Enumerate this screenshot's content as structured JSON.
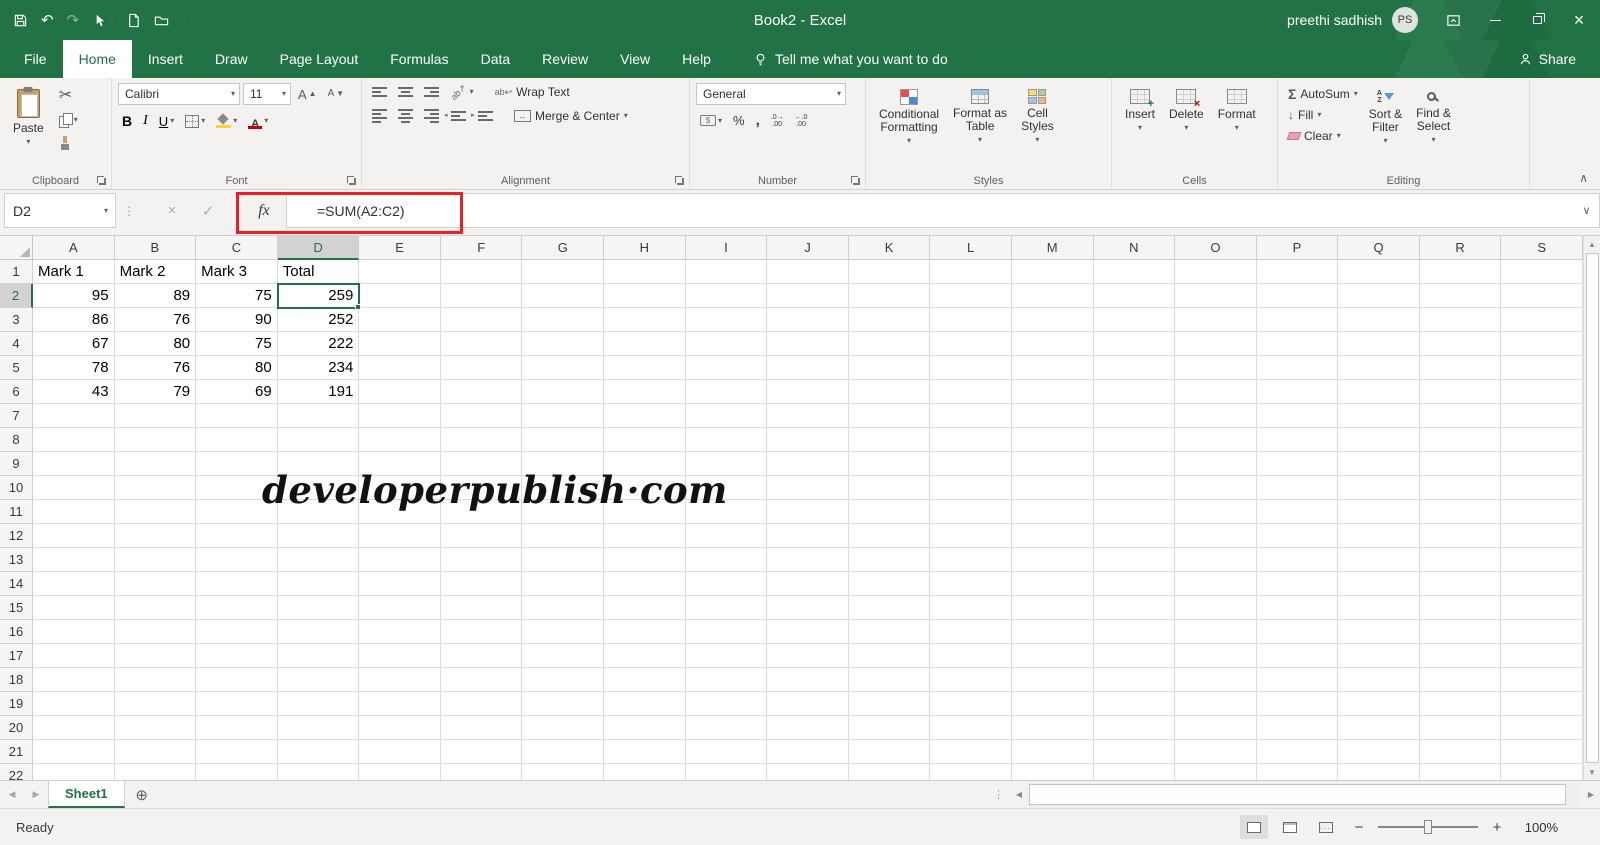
{
  "colors": {
    "excel_green": "#217346",
    "annotation_red": "#ec2024",
    "fill_yellow": "#ffd43b",
    "font_color_red": "#c00000",
    "selection_border": "#217346"
  },
  "icons": {
    "dropdown": "▾",
    "cut": "✂",
    "undo": "↶",
    "redo": "↷",
    "check": "✓",
    "cancel": "×",
    "close": "×",
    "ellipsis": "⋮",
    "chevron_up": "∧",
    "chevron_down": "∨",
    "add_sheet": "⊕",
    "left": "◀",
    "right": "▶",
    "up": "▲",
    "down": "▼",
    "minus": "−",
    "plus": "+",
    "fill_down": "↓",
    "merge_arrows": "↔"
  },
  "title_bar": {
    "title": "Book2  -  Excel",
    "user_name": "preethi sadhish",
    "user_initials": "PS"
  },
  "ribbon_tabs": [
    {
      "id": "file",
      "label": "File",
      "active": false
    },
    {
      "id": "home",
      "label": "Home",
      "active": true
    },
    {
      "id": "insert",
      "label": "Insert",
      "active": false
    },
    {
      "id": "draw",
      "label": "Draw",
      "active": false
    },
    {
      "id": "page-layout",
      "label": "Page Layout",
      "active": false
    },
    {
      "id": "formulas",
      "label": "Formulas",
      "active": false
    },
    {
      "id": "data",
      "label": "Data",
      "active": false
    },
    {
      "id": "review",
      "label": "Review",
      "active": false
    },
    {
      "id": "view",
      "label": "View",
      "active": false
    },
    {
      "id": "help",
      "label": "Help",
      "active": false
    }
  ],
  "tell_me": {
    "label": "Tell me what you want to do"
  },
  "share": {
    "label": "Share"
  },
  "ribbon": {
    "clipboard": {
      "group_label": "Clipboard",
      "paste_label": "Paste"
    },
    "font": {
      "group_label": "Font",
      "font_name": "Calibri",
      "font_size": "11",
      "bold": "B",
      "italic": "I",
      "underline": "U"
    },
    "alignment": {
      "group_label": "Alignment",
      "wrap_text_label": "Wrap Text",
      "merge_center_label": "Merge & Center"
    },
    "number": {
      "group_label": "Number",
      "format_value": "General",
      "percent": "%",
      "comma": ","
    },
    "styles": {
      "group_label": "Styles",
      "conditional_formatting_line1": "Conditional",
      "conditional_formatting_line2": "Formatting",
      "format_as_table_line1": "Format as",
      "format_as_table_line2": "Table",
      "cell_styles_line1": "Cell",
      "cell_styles_line2": "Styles"
    },
    "cells": {
      "group_label": "Cells",
      "insert_label": "Insert",
      "delete_label": "Delete",
      "format_label": "Format"
    },
    "editing": {
      "group_label": "Editing",
      "sigma": "Σ",
      "autosum_label": "AutoSum",
      "fill_label": "Fill",
      "clear_label": "Clear",
      "sort_filter_line1": "Sort &",
      "sort_filter_line2": "Filter",
      "find_select_line1": "Find &",
      "find_select_line2": "Select"
    }
  },
  "formula_bar": {
    "name_box_value": "D2",
    "fx_label": "fx",
    "formula_value": "=SUM(A2:C2)"
  },
  "sheet": {
    "columns": [
      "A",
      "B",
      "C",
      "D",
      "E",
      "F",
      "G",
      "H",
      "I",
      "J",
      "K",
      "L",
      "M",
      "N",
      "O",
      "P",
      "Q",
      "R",
      "S"
    ],
    "row_count": 22,
    "selection": {
      "ref": "D2",
      "column": "D",
      "row": 2
    },
    "data_rows": [
      {
        "row": 1,
        "cells": {
          "A": "Mark 1",
          "B": "Mark 2",
          "C": "Mark 3",
          "D": "Total"
        }
      },
      {
        "row": 2,
        "cells": {
          "A": "95",
          "B": "89",
          "C": "75",
          "D": "259"
        }
      },
      {
        "row": 3,
        "cells": {
          "A": "86",
          "B": "76",
          "C": "90",
          "D": "252"
        }
      },
      {
        "row": 4,
        "cells": {
          "A": "67",
          "B": "80",
          "C": "75",
          "D": "222"
        }
      },
      {
        "row": 5,
        "cells": {
          "A": "78",
          "B": "76",
          "C": "80",
          "D": "234"
        }
      },
      {
        "row": 6,
        "cells": {
          "A": "43",
          "B": "79",
          "C": "69",
          "D": "191"
        }
      }
    ],
    "watermark_text": "developerpublish·com"
  },
  "sheet_tabs": {
    "active_tab_label": "Sheet1"
  },
  "status_bar": {
    "mode": "Ready",
    "zoom_level": "100%"
  }
}
